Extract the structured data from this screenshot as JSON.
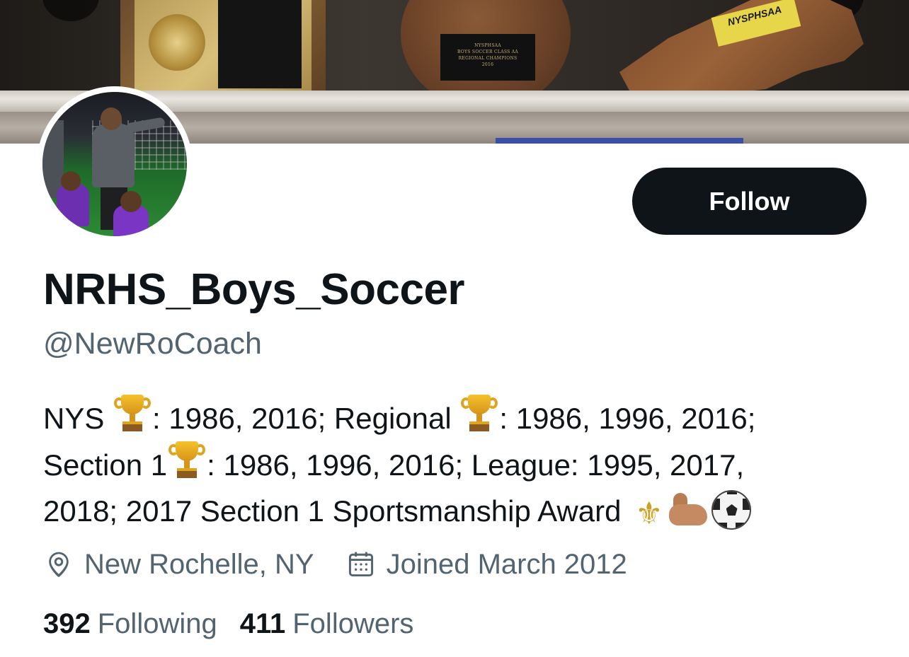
{
  "banner": {
    "round_plaque_text": [
      "NYSPHSAA",
      "BOYS SOCCER CLASS AA",
      "REGIONAL CHAMPIONS",
      "2016"
    ],
    "state_trophy_label": "NYSPHSAA"
  },
  "profile": {
    "display_name": "NRHS_Boys_Soccer",
    "handle": "@NewRoCoach",
    "follow_label": "Follow",
    "bio": {
      "line1_a": "NYS",
      "line1_b": ": 1986, 2016; Regional",
      "line1_c": ": 1986, 1996, 2016;",
      "line2_a": "Section 1",
      "line2_b": ": 1986, 1996, 2016; League: 1995, 2017,",
      "line3_a": "2018; 2017 Section 1 Sportsmanship Award"
    },
    "location": "New Rochelle, NY",
    "joined": "Joined March 2012",
    "following_count": "392",
    "following_label": "Following",
    "followers_count": "411",
    "followers_label": "Followers"
  },
  "icons": {
    "location": "location-pin-icon",
    "calendar": "calendar-icon",
    "trophy": "trophy-emoji",
    "fleur": "fleur-de-lis-emoji",
    "muscle": "flexed-biceps-emoji",
    "ball": "soccer-ball-emoji"
  },
  "colors": {
    "text_primary": "#0f1419",
    "text_secondary": "#536471",
    "follow_bg": "#0f1419",
    "follow_text": "#ffffff"
  }
}
